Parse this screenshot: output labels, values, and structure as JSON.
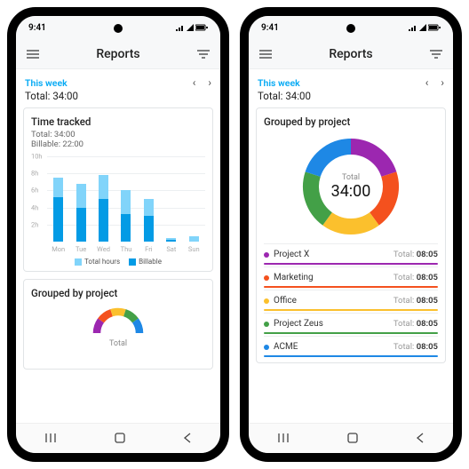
{
  "status_time": "9:41",
  "app_title": "Reports",
  "range_label": "This week",
  "total_label": "Total:",
  "total_value": "34:00",
  "left": {
    "card_title": "Time tracked",
    "total_line": "Total: 34:00",
    "billable_line": "Billable: 22:00",
    "legend_a": "Total hours",
    "legend_b": "Billable",
    "grouped_title": "Grouped by project",
    "donut_center_label": "Total"
  },
  "right": {
    "grouped_title": "Grouped by project",
    "donut_center_label": "Total",
    "donut_center_value": "34:00",
    "projects": [
      {
        "name": "Project X",
        "total": "08:05",
        "color": "#9c27b0"
      },
      {
        "name": "Marketing",
        "total": "08:05",
        "color": "#f4511e"
      },
      {
        "name": "Office",
        "total": "08:05",
        "color": "#fbc02d"
      },
      {
        "name": "Project Zeus",
        "total": "08:05",
        "color": "#43a047"
      },
      {
        "name": "ACME",
        "total": "08:05",
        "color": "#1e88e5"
      }
    ]
  },
  "chart_data": [
    {
      "type": "bar",
      "title": "Time tracked",
      "xlabel": "",
      "ylabel": "",
      "ylim": [
        0,
        10
      ],
      "y_unit": "h",
      "y_ticks": [
        2,
        4,
        6,
        8,
        10
      ],
      "categories": [
        "Mon",
        "Tue",
        "Wed",
        "Thu",
        "Fri",
        "Sat",
        "Sun"
      ],
      "series": [
        {
          "name": "Billable",
          "values": [
            5.2,
            4.0,
            5.0,
            3.2,
            3.0,
            0.2,
            0.0
          ],
          "color": "#039be5"
        },
        {
          "name": "Total hours",
          "values": [
            7.5,
            6.8,
            7.8,
            6.0,
            5.0,
            0.4,
            0.6
          ],
          "color": "#81d4fa"
        }
      ]
    },
    {
      "type": "pie",
      "title": "Grouped by project",
      "center_label": "Total",
      "center_value": "34:00",
      "slices": [
        {
          "name": "Project X",
          "value": 8.08,
          "color": "#9c27b0"
        },
        {
          "name": "Marketing",
          "value": 8.08,
          "color": "#f4511e"
        },
        {
          "name": "Office",
          "value": 8.08,
          "color": "#fbc02d"
        },
        {
          "name": "Project Zeus",
          "value": 8.08,
          "color": "#43a047"
        },
        {
          "name": "ACME",
          "value": 8.08,
          "color": "#1e88e5"
        }
      ]
    }
  ]
}
